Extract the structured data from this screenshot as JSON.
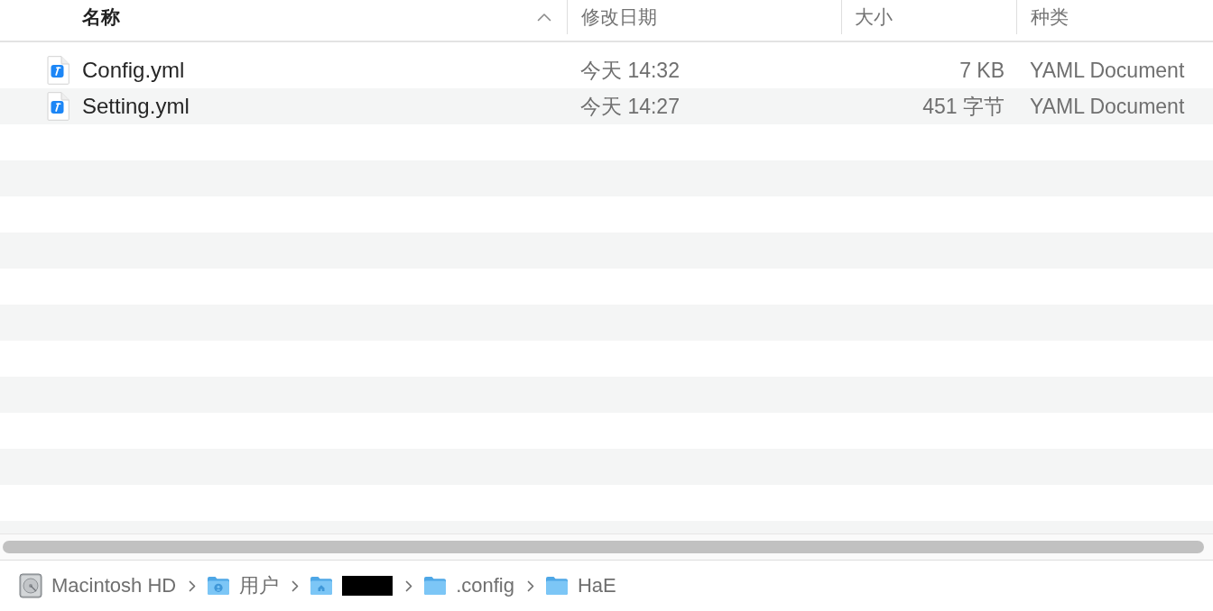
{
  "columns": [
    {
      "label": "名称",
      "sorted": true
    },
    {
      "label": "修改日期",
      "sorted": false
    },
    {
      "label": "大小",
      "sorted": false
    },
    {
      "label": "种类",
      "sorted": false
    }
  ],
  "files": [
    {
      "name": "Config.yml",
      "modified": "今天 14:32",
      "size": "7 KB",
      "doc_kind": "YAML Document"
    },
    {
      "name": "Setting.yml",
      "modified": "今天 14:27",
      "size": "451 字节",
      "doc_kind": "YAML Document"
    }
  ],
  "path_bar": [
    {
      "kind": "drive",
      "label": "Macintosh HD",
      "redacted": false
    },
    {
      "kind": "user-folder",
      "label": "用户",
      "redacted": false
    },
    {
      "kind": "home-folder",
      "redacted": true
    },
    {
      "kind": "folder",
      "label": ".config",
      "redacted": false
    },
    {
      "kind": "folder",
      "label": "HaE",
      "redacted": false
    }
  ]
}
